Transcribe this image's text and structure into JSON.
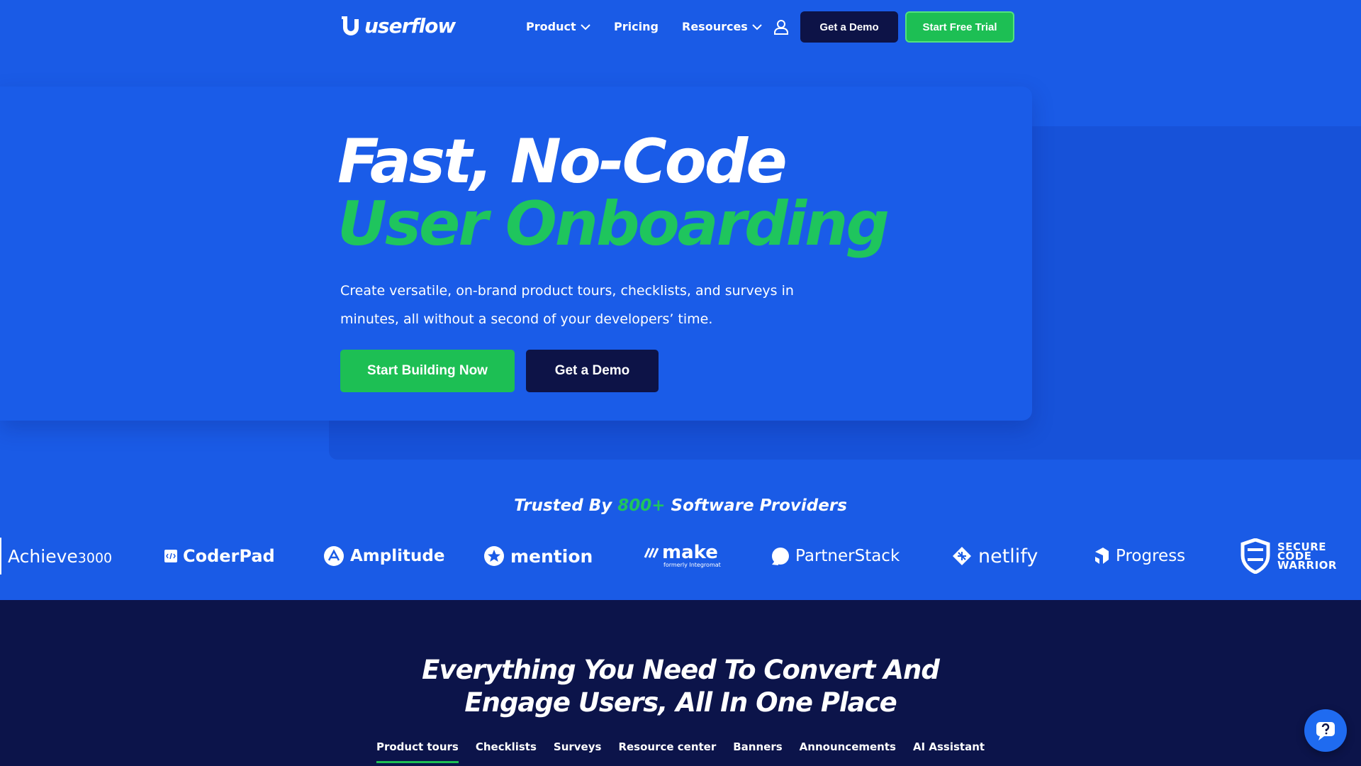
{
  "header": {
    "logo_text": "userflow",
    "nav": [
      {
        "label": "Product"
      },
      {
        "label": "Pricing"
      },
      {
        "label": "Resources"
      }
    ],
    "demo_label": "Get a Demo",
    "trial_label": "Start Free Trial"
  },
  "hero": {
    "title_line1": "Fast, No-Code",
    "title_line2": "User Onboarding",
    "subtitle": "Create versatile, on-brand product tours, checklists, and surveys in minutes, all without a second of your developers’ time.",
    "primary_cta": "Start Building Now",
    "secondary_cta": "Get a Demo"
  },
  "trusted": {
    "prefix": "Trusted By ",
    "count": "800+",
    "suffix": " Software Providers"
  },
  "logos": {
    "achieve_a": "Achieve",
    "achieve_b": "3000",
    "coderpad": "CoderPad",
    "amplitude": "Amplitude",
    "mention": "mention",
    "make": "make",
    "make_sub": "formerly Integromat",
    "partnerstack": "PartnerStack",
    "netlify": "netlify",
    "progress": "Progress",
    "scw1": "SECURE",
    "scw2": "CODE",
    "scw3": "WARRIOR"
  },
  "features": {
    "title_line1": "Everything You Need To Convert And",
    "title_line2": "Engage Users, All In One Place",
    "tabs": [
      {
        "label": "Product tours"
      },
      {
        "label": "Checklists"
      },
      {
        "label": "Surveys"
      },
      {
        "label": "Resource center"
      },
      {
        "label": "Banners"
      },
      {
        "label": "Announcements"
      },
      {
        "label": "AI Assistant"
      }
    ]
  },
  "colors": {
    "brand_blue": "#1a5be6",
    "accent_green": "#1fc55d",
    "navy": "#0d1347"
  }
}
